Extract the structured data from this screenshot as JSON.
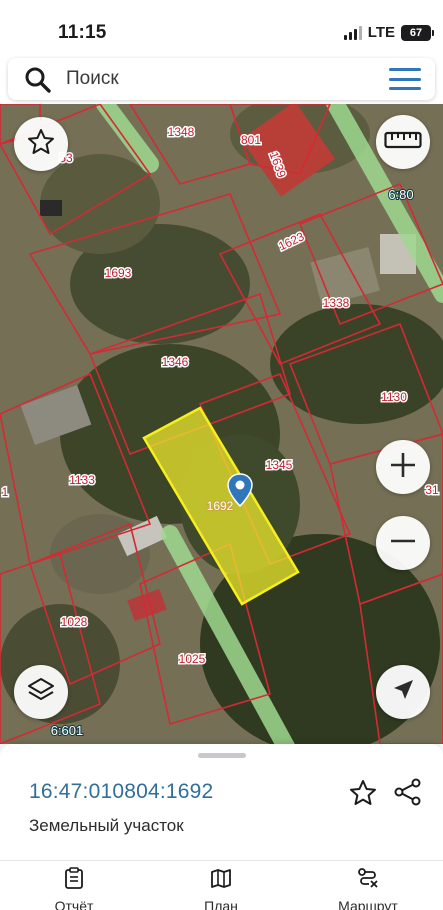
{
  "status_bar": {
    "time": "11:15",
    "network": "LTE",
    "battery": "67"
  },
  "search": {
    "label": "Поиск"
  },
  "map": {
    "parcels": [
      "1348",
      "801",
      "1639",
      "53",
      "6:80",
      "1623",
      "1693",
      "1338",
      "1346",
      "1130",
      "1345",
      "1133",
      "1692",
      "31",
      "1028",
      "1025",
      "6:601",
      "1"
    ],
    "selected_parcel": "1692"
  },
  "sheet": {
    "cadastral_number": "16:47:010804:1692",
    "parcel_type": "Земельный участок"
  },
  "tabs": [
    {
      "label": "Отчёт",
      "icon": "report-icon"
    },
    {
      "label": "План",
      "icon": "map-plan-icon"
    },
    {
      "label": "Маршрут",
      "icon": "route-icon"
    }
  ],
  "colors": {
    "accent": "#2f77b8",
    "parcel_border": "#d42a35",
    "selected_fill": "#f3ee2c",
    "road": "#9fd88f"
  }
}
